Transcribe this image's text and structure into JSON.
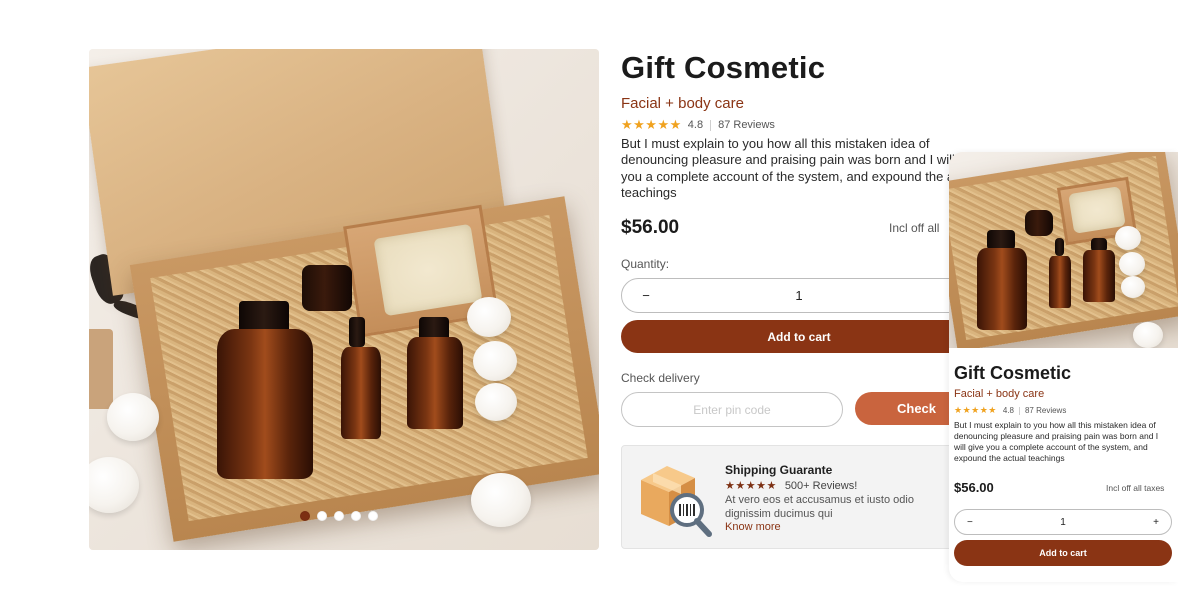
{
  "product": {
    "title": "Gift Cosmetic",
    "subtitle": "Facial + body care",
    "rating": "4.8",
    "reviews": "87 Reviews",
    "stars": "★★★★★",
    "description": "But I must explain to you how all this mistaken idea of denouncing pleasure and praising pain was born and I will give you a complete account of the system, and expound the actual teachings",
    "description_truncated": "But I must explain to you how all this mistaken idea of denouncing pleasure and praising pain was born and I will gi you a complete account of the system, and expound the ac teachings",
    "price": "$56.00",
    "tax_note": "Incl off all",
    "tax_note_full": "Incl off all taxes"
  },
  "gallery": {
    "slides": 5,
    "active_slide": 1
  },
  "quantity": {
    "label": "Quantity:",
    "value": "1",
    "minus": "−",
    "plus": "+"
  },
  "actions": {
    "add_to_cart": "Add to cart",
    "check_delivery_label": "Check delivery",
    "pin_placeholder": "Enter pin code",
    "check": "Check"
  },
  "shipping": {
    "title": "Shipping Guarante",
    "stars": "★★★★★",
    "reviews": "500+ Reviews!",
    "description": "At vero eos et accusamus et iusto odio dignissim ducimus qui",
    "link": "Know more"
  },
  "colors": {
    "brand": "#8a3414",
    "accent": "#c9643e",
    "star": "#f0a21f"
  }
}
